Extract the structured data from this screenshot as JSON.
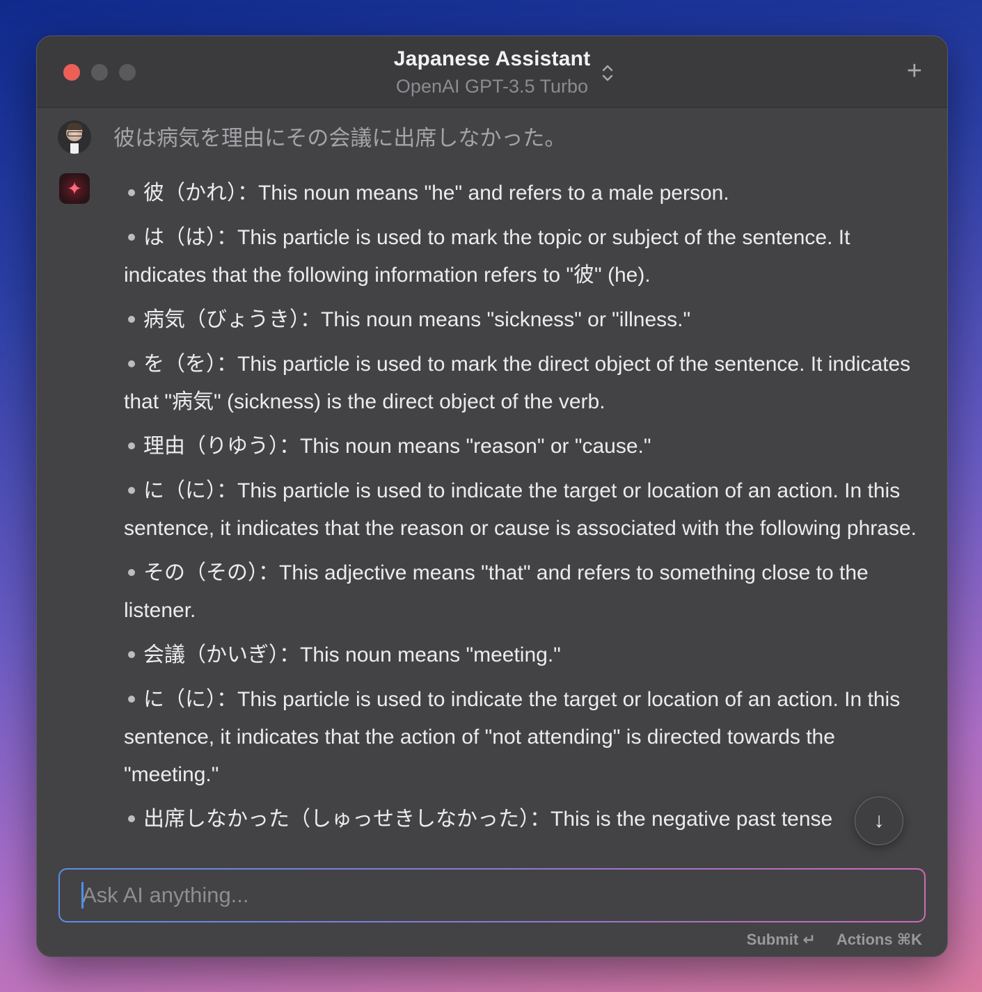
{
  "window": {
    "title": "Japanese Assistant",
    "subtitle": "OpenAI GPT-3.5 Turbo",
    "new_chat_label": "+"
  },
  "chat": {
    "user_message": "彼は病気を理由にその会議に出席しなかった。",
    "ai_items": [
      "彼（かれ）：This noun means \"he\" and refers to a male person.",
      "は（は）：This particle is used to mark the topic or subject of the sentence. It indicates that the following information refers to \"彼\" (he).",
      "病気（びょうき）：This noun means \"sickness\" or \"illness.\"",
      "を（を）：This particle is used to mark the direct object of the sentence. It indicates that \"病気\" (sickness) is the direct object of the verb.",
      "理由（りゆう）：This noun means \"reason\" or \"cause.\"",
      "に（に）：This particle is used to indicate the target or location of an action. In this sentence, it indicates that the reason or cause is associated with the following phrase.",
      "その（その）：This adjective means \"that\" and refers to something close to the listener.",
      "会議（かいぎ）：This noun means \"meeting.\"",
      "に（に）：This particle is used to indicate the target or location of an action. In this sentence, it indicates that the action of \"not attending\" is directed towards the \"meeting.\"",
      "出席しなかった（しゅっせきしなかった）：This is the negative past tense"
    ]
  },
  "composer": {
    "placeholder": "Ask AI anything...",
    "submit_label": "Submit ↵",
    "actions_label": "Actions ⌘K"
  },
  "icons": {
    "scroll_down": "arrow-down-icon",
    "model_switch": "chevron-up-down-icon",
    "ai_avatar": "sparkle-icon"
  },
  "colors": {
    "close": "#ec5f57",
    "window_bg": "#434345",
    "caret": "#4e8ff0"
  }
}
